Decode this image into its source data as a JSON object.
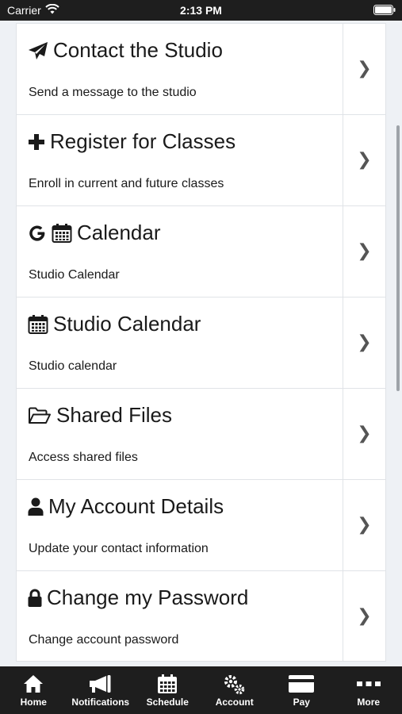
{
  "status_bar": {
    "carrier": "Carrier",
    "time": "2:13 PM"
  },
  "menu": [
    {
      "title": "Contact the Studio",
      "subtitle": "Send a message to the studio",
      "icon": "paper-plane-icon"
    },
    {
      "title": "Register for Classes",
      "subtitle": "Enroll in current and future classes",
      "icon": "plus-icon"
    },
    {
      "title": "Calendar",
      "subtitle": "Studio Calendar",
      "icon": "google-calendar-icon"
    },
    {
      "title": "Studio Calendar",
      "subtitle": "Studio calendar",
      "icon": "calendar-icon"
    },
    {
      "title": "Shared Files",
      "subtitle": "Access shared files",
      "icon": "folder-open-icon"
    },
    {
      "title": "My Account Details",
      "subtitle": "Update your contact information",
      "icon": "user-icon"
    },
    {
      "title": "Change my Password",
      "subtitle": "Change account password",
      "icon": "lock-icon"
    }
  ],
  "tabs": [
    {
      "label": "Home",
      "icon": "home-icon"
    },
    {
      "label": "Notifications",
      "icon": "megaphone-icon"
    },
    {
      "label": "Schedule",
      "icon": "calendar-grid-icon"
    },
    {
      "label": "Account",
      "icon": "gears-icon"
    },
    {
      "label": "Pay",
      "icon": "credit-card-icon"
    },
    {
      "label": "More",
      "icon": "more-dots-icon"
    }
  ],
  "chevron": "❯"
}
